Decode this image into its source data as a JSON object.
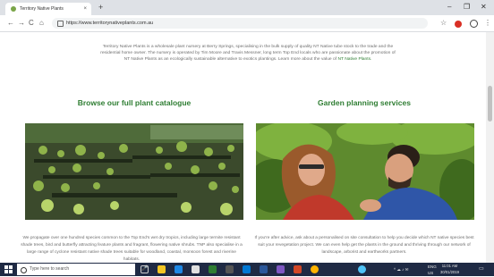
{
  "browser": {
    "tab_title": "Territory Native Plants",
    "tab_close": "×",
    "new_tab": "+",
    "url": "https://www.territorynativeplants.com.au",
    "window_controls": {
      "minimize": "–",
      "maximize": "❐",
      "close": "✕"
    },
    "nav": {
      "back": "←",
      "forward": "→",
      "reload": "C",
      "home": "⌂"
    },
    "star": "☆",
    "menu": "⋮"
  },
  "page": {
    "intro_text": "Territory Native Plants is a wholesale plant nursery at Berry Springs, specialising in the bulk supply of quality NT Native tube stock to the trade and the residential home owner. The nursery is operated by Tim Moore and Travis Messner, long term Top End locals who are passionate about the promotion of NT Native Plants as an ecologically sustainable alternative to exotics plantings. Learn more about the value of",
    "intro_link": "NT Native Plants.",
    "left_heading": "Browse our full plant catalogue",
    "right_heading": "Garden planning services",
    "left_desc": "We propagate over one hundred species common to the Top End's wet dry tropics, including large termite resistant shade trees, bird and butterfly attracting feature plants and fragrant, flowering native shrubs. TNP also specialise in a large range of cyclone resistant native shade trees suitable for woodland, coastal, monsoon forest and riverine habitats.",
    "right_desc": "If you're after advice, ask about a personalised on site consultation to help you decide which NT native species best suit your revegetation project. We can even help get the plants in the ground and thriving through our network of landscape, arborist and earthworks partners."
  },
  "taskbar": {
    "search_placeholder": "Type here to search",
    "lang": "ENG",
    "region": "US",
    "time": "11:01 AM",
    "date": "30/01/2019"
  },
  "colors": {
    "heading_green": "#2e7d32",
    "taskbar": "#1f2a44",
    "tab_strip": "#dee1e6"
  }
}
